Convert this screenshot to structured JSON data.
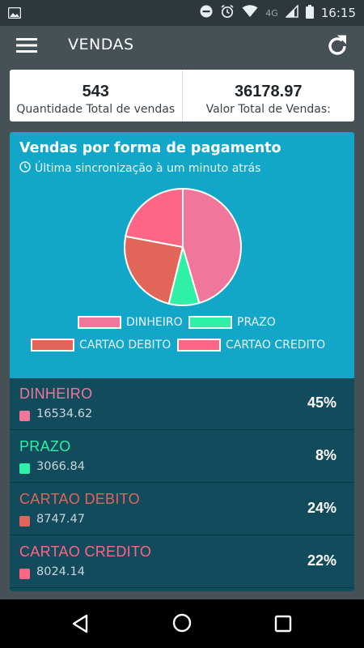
{
  "status_bar": {
    "network": "4G",
    "time": "16:15"
  },
  "app_bar": {
    "title": "VENDAS"
  },
  "summary": {
    "quantity_value": "543",
    "quantity_label": "Quantidade Total de vendas",
    "amount_value": "36178.97",
    "amount_label": "Valor Total de Vendas:"
  },
  "card": {
    "title": "Vendas por forma de pagamento",
    "subtitle": "Última sincronização à um minuto atrás"
  },
  "chart_data": {
    "type": "pie",
    "categories": [
      "DINHEIRO",
      "PRAZO",
      "CARTAO DEBITO",
      "CARTAO CREDITO"
    ],
    "values": [
      16534.62,
      3066.84,
      8747.47,
      8024.14
    ],
    "colors": [
      "#f0769b",
      "#2ef0a6",
      "#e2655a",
      "#ff6584"
    ],
    "legend_position": "bottom"
  },
  "payments": [
    {
      "name": "DINHEIRO",
      "value": "16534.62",
      "percent": "45%",
      "color": "#f0769b"
    },
    {
      "name": "PRAZO",
      "value": "3066.84",
      "percent": "8%",
      "color": "#2ef0a6"
    },
    {
      "name": "CARTAO DEBITO",
      "value": "8747.47",
      "percent": "24%",
      "color": "#e2655a"
    },
    {
      "name": "CARTAO CREDITO",
      "value": "8024.14",
      "percent": "22%",
      "color": "#ff6584"
    }
  ],
  "icons": {
    "menu": "hamburger-icon",
    "refresh": "refresh-icon",
    "clock": "clock-icon",
    "back": "back-triangle-icon",
    "home": "home-circle-icon",
    "recents": "recents-square-icon"
  }
}
